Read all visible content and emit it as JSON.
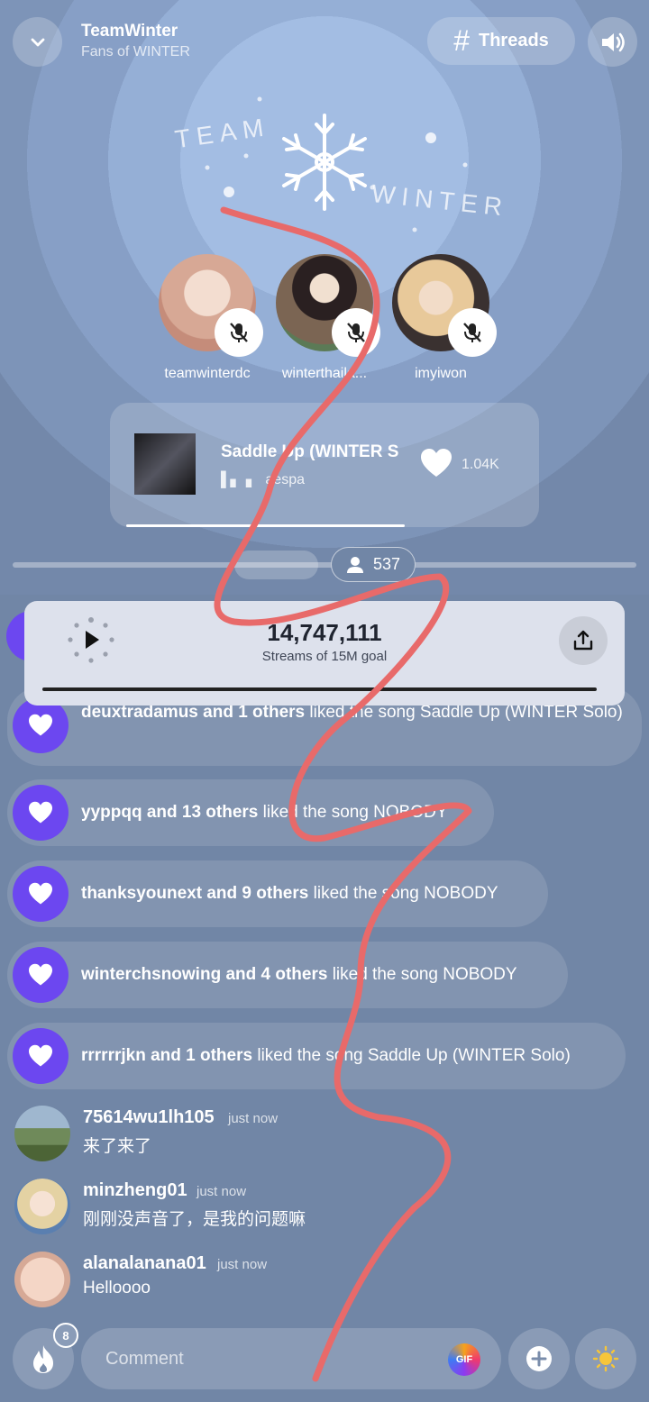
{
  "header": {
    "title": "TeamWinter",
    "subtitle": "Fans of WINTER",
    "threads_label": "Threads",
    "threads_icon": "hash",
    "back_icon": "chevron-down",
    "sound_icon": "speaker"
  },
  "logo": {
    "word_left": "TEAM",
    "word_right": "WINTER"
  },
  "speakers": [
    {
      "name": "teamwinterdc",
      "muted": true,
      "avatar_color": "#e9c6b3"
    },
    {
      "name": "winterthaila...",
      "muted": true,
      "avatar_color": "#8a6b52"
    },
    {
      "name": "imyiwon",
      "muted": true,
      "avatar_color": "#3a3130"
    }
  ],
  "now_playing": {
    "title": "Saddle Up (WINTER S",
    "artist": "aespa",
    "likes": "1.04K",
    "progress": 0.65
  },
  "room": {
    "listener_count": "537"
  },
  "stream": {
    "count": "14,747,111",
    "label": "Streams of 15M goal",
    "progress": 0.983
  },
  "feed": [
    {
      "user_part": "deuxtradamus and 1 others",
      "rest": " liked the song Saddle Up (WINTER Solo)"
    },
    {
      "user_part": "yyppqq and 13 others",
      "rest": " liked the song NOBODY"
    },
    {
      "user_part": "thanksyounext and 9 others",
      "rest": " liked the song NOBODY"
    },
    {
      "user_part": "winterchsnowing and 4 others",
      "rest": " liked the song NOBODY"
    },
    {
      "user_part": "rrrrrrjkn and 1 others",
      "rest": " liked the song Saddle Up (WINTER Solo)"
    }
  ],
  "comments": [
    {
      "user": "75614wu1lh105",
      "time": "just now",
      "text": "来了来了",
      "avatar_color": "#5d7a4a"
    },
    {
      "user": "minzheng01",
      "time": "just now",
      "text": "刚刚没声音了，是我的问题嘛",
      "avatar_color": "#d9c3a0"
    },
    {
      "user": "alanalanana01",
      "time": "just now",
      "text": "Helloooo",
      "avatar_color": "#e8c4b0"
    }
  ],
  "composer": {
    "placeholder": "Comment",
    "gif_label": "GIF",
    "fire_badge": "8",
    "fire_icon": "flame",
    "plus_icon": "plus",
    "sun_icon": "sun"
  },
  "colors": {
    "background": "#7186a6",
    "accent_purple": "#6c47f0",
    "annotation_red": "#e86a6a"
  }
}
